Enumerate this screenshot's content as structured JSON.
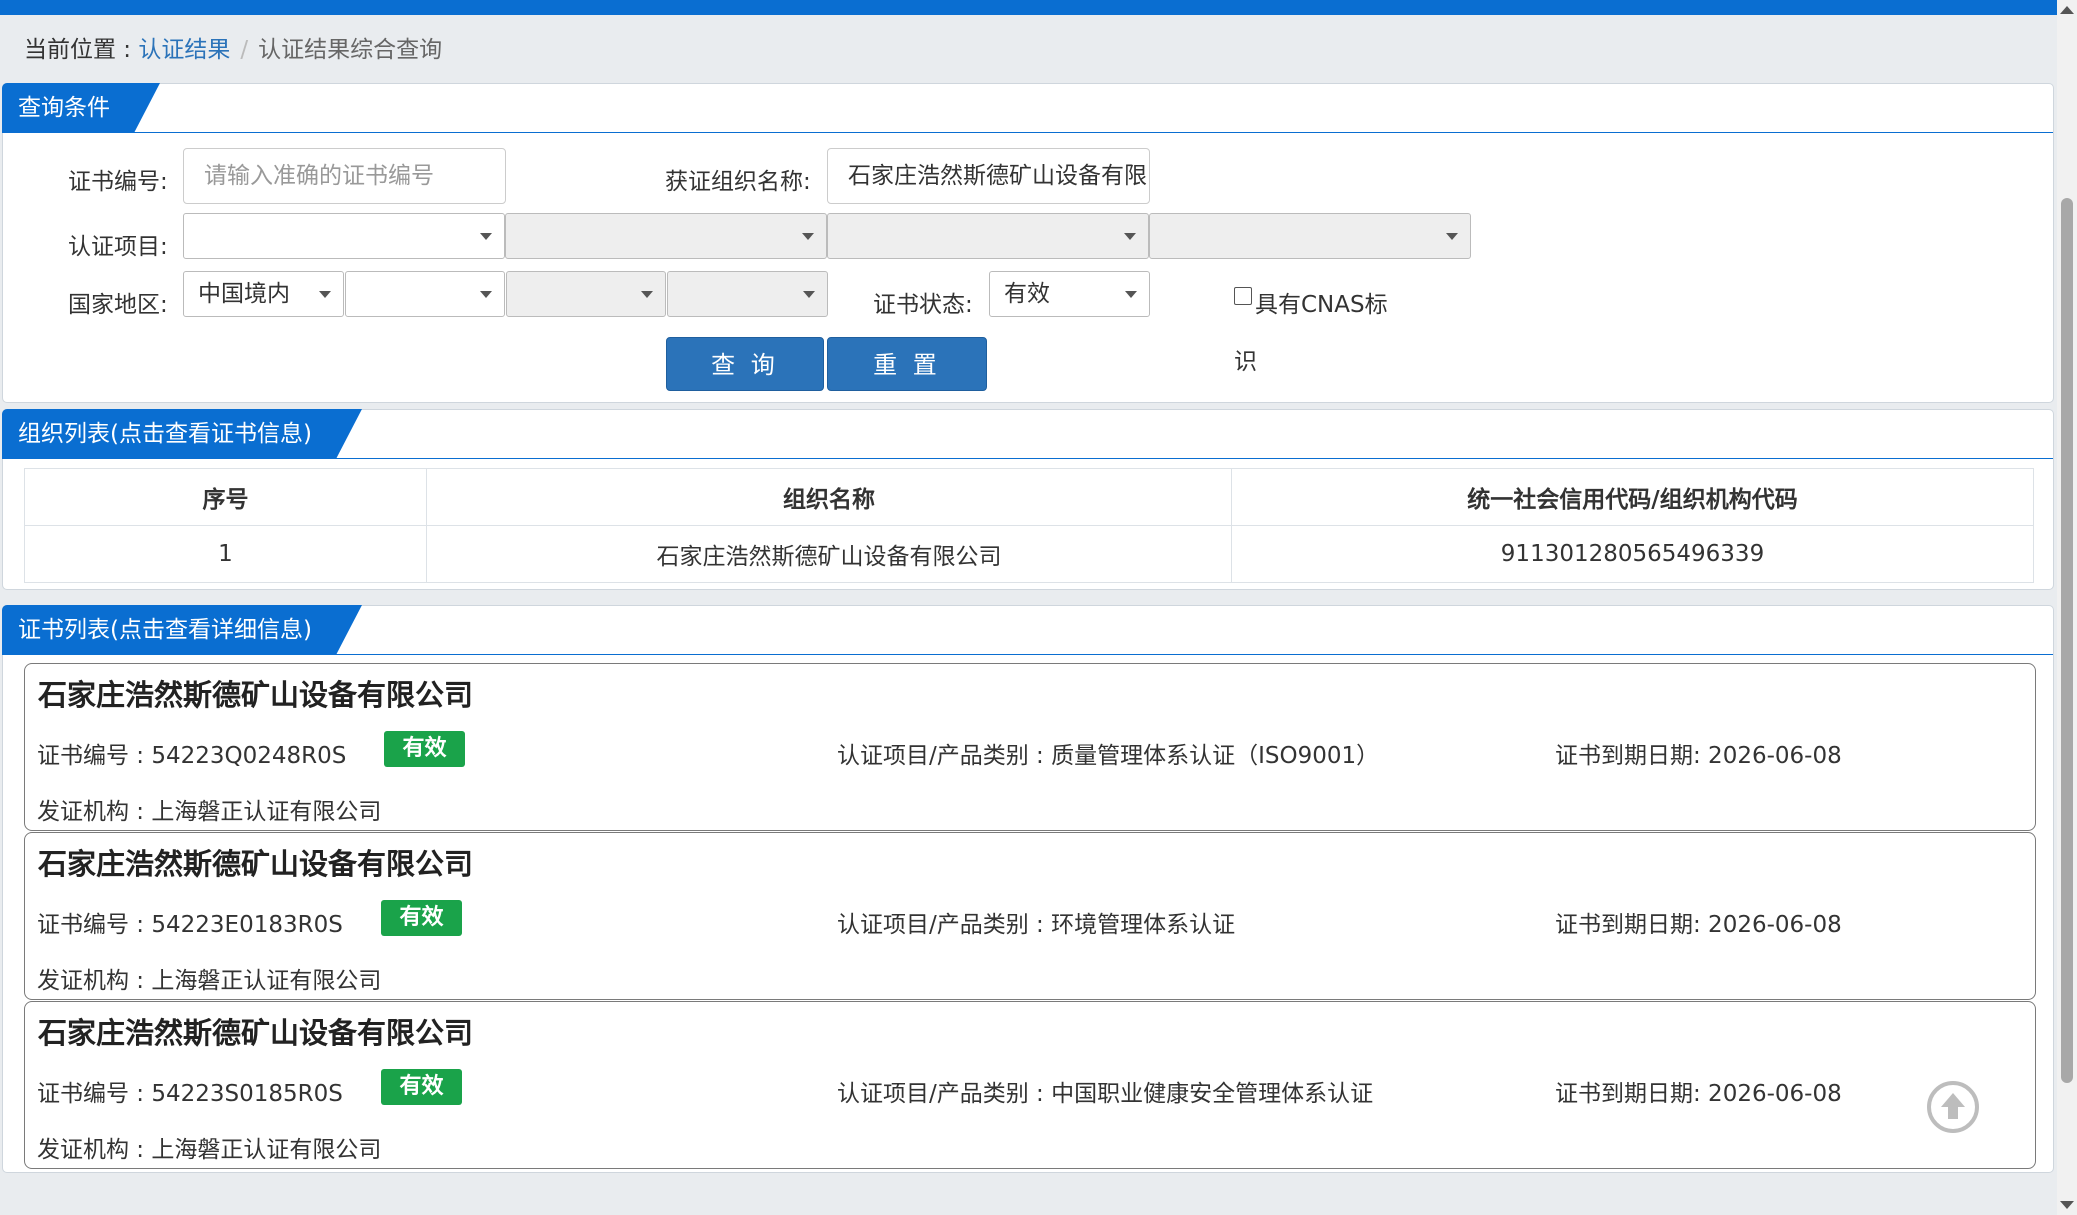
{
  "breadcrumb": {
    "prefix": "当前位置 : ",
    "link": "认证结果",
    "separator": "/",
    "current": "认证结果综合查询"
  },
  "query_panel": {
    "title": "查询条件",
    "cert_no_label": "证书编号:",
    "cert_no_placeholder": "请输入准确的证书编号",
    "org_name_label": "获证组织名称:",
    "org_name_value": "石家庄浩然斯德矿山设备有限",
    "project_label": "认证项目:",
    "region_label": "国家地区:",
    "region_value": "中国境内",
    "status_label": "证书状态:",
    "status_value": "有效",
    "cnas_label_1": "具有CNAS标",
    "cnas_label_2": "识",
    "query_button": "查 询",
    "reset_button": "重 置"
  },
  "org_panel": {
    "title": "组织列表(点击查看证书信息)",
    "columns": [
      "序号",
      "组织名称",
      "统一社会信用代码/组织机构代码"
    ],
    "rows": [
      [
        "1",
        "石家庄浩然斯德矿山设备有限公司",
        "911301280565496339"
      ]
    ]
  },
  "cert_panel": {
    "title": "证书列表(点击查看详细信息)",
    "certs": [
      {
        "org": "石家庄浩然斯德矿山设备有限公司",
        "cert_no": "证书编号 : 54223Q0248R0S",
        "status": "有效",
        "project": "认证项目/产品类别 : 质量管理体系认证（ISO9001）",
        "expiry": "证书到期日期: 2026-06-08",
        "issuer": "发证机构 : 上海磐正认证有限公司"
      },
      {
        "org": "石家庄浩然斯德矿山设备有限公司",
        "cert_no": "证书编号 : 54223E0183R0S",
        "status": "有效",
        "project": "认证项目/产品类别 : 环境管理体系认证",
        "expiry": "证书到期日期: 2026-06-08",
        "issuer": "发证机构 : 上海磐正认证有限公司"
      },
      {
        "org": "石家庄浩然斯德矿山设备有限公司",
        "cert_no": "证书编号 : 54223S0185R0S",
        "status": "有效",
        "project": "认证项目/产品类别 : 中国职业健康安全管理体系认证",
        "expiry": "证书到期日期: 2026-06-08",
        "issuer": "发证机构 : 上海磐正认证有限公司"
      }
    ]
  },
  "colors": {
    "primary": "#0a6ed1",
    "button": "#2b73b9",
    "valid_badge": "#1aa34a",
    "page_bg": "#e9ecef"
  },
  "icons": {
    "back_to_top": "arrow-up-circle-icon",
    "select_caret": "caret-down-icon"
  }
}
